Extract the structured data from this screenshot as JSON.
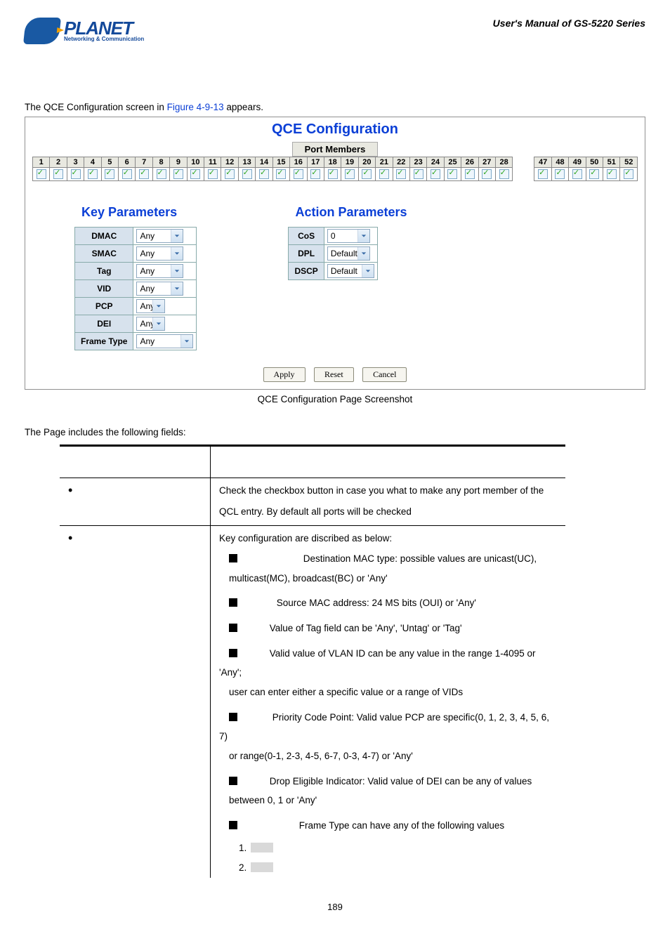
{
  "header": {
    "brand": "PLANET",
    "sub": "Networking & Communication",
    "manual": "User's Manual of GS-5220 Series"
  },
  "intro": {
    "t1": "The QCE Configuration screen in ",
    "figref": "Figure 4-9-13",
    "t2": " appears."
  },
  "shot": {
    "title": "QCE Configuration",
    "port_label": "Port Members",
    "ports_a": [
      "1",
      "2",
      "3",
      "4",
      "5",
      "6",
      "7",
      "8",
      "9",
      "10",
      "11",
      "12",
      "13",
      "14",
      "15",
      "16",
      "17",
      "18",
      "19",
      "20",
      "21",
      "22",
      "23",
      "24",
      "25",
      "26",
      "27",
      "28"
    ],
    "ports_b": [
      "47",
      "48",
      "49",
      "50",
      "51",
      "52"
    ],
    "key_title": "Key Parameters",
    "action_title": "Action Parameters",
    "key_rows": [
      {
        "label": "DMAC",
        "value": "Any",
        "w": "sw40"
      },
      {
        "label": "SMAC",
        "value": "Any",
        "w": "sw40"
      },
      {
        "label": "Tag",
        "value": "Any",
        "w": "sw40"
      },
      {
        "label": "VID",
        "value": "Any",
        "w": "sw40"
      },
      {
        "label": "PCP",
        "value": "Any",
        "w": "sw14"
      },
      {
        "label": "DEI",
        "value": "Any",
        "w": "sw14"
      },
      {
        "label": "Frame Type",
        "value": "Any",
        "w": "sw54"
      }
    ],
    "action_rows": [
      {
        "label": "CoS",
        "value": "0",
        "w": "sw34"
      },
      {
        "label": "DPL",
        "value": "Default",
        "w": "sw34"
      },
      {
        "label": "DSCP",
        "value": "Default",
        "w": "sw40"
      }
    ],
    "buttons": {
      "apply": "Apply",
      "reset": "Reset",
      "cancel": "Cancel"
    }
  },
  "caption": "QCE Configuration Page Screenshot",
  "fields_intro": "The Page includes the following fields:",
  "row1": {
    "l1": "Check the checkbox button in case you what to make any port member of the",
    "l2": "QCL entry. By default all ports will be checked"
  },
  "row2": {
    "intro": "Key configuration are discribed as below:",
    "dmac_b": " Destination MAC type: possible values are unicast(UC),",
    "dmac_c": "multicast(MC), broadcast(BC) or 'Any'",
    "smac": " Source MAC address: 24 MS bits (OUI) or 'Any'",
    "tag": " Value of Tag field can be 'Any', 'Untag' or 'Tag'",
    "vid_a": " Valid value of VLAN ID can be any value in the range 1-4095 or 'Any';",
    "vid_b": "user can enter either a specific value or a range of VIDs",
    "pcp_a": " Priority Code Point: Valid value PCP are specific(0, 1, 2, 3, 4, 5, 6, 7)",
    "pcp_b": "or range(0-1, 2-3, 4-5, 6-7, 0-3, 4-7) or 'Any'",
    "dei_a": " Drop Eligible Indicator: Valid value of DEI can be any of values",
    "dei_b": "between 0, 1 or 'Any'",
    "ft": " Frame Type can have any of the following values",
    "n1": "1.",
    "n2": "2."
  },
  "pageno": "189"
}
